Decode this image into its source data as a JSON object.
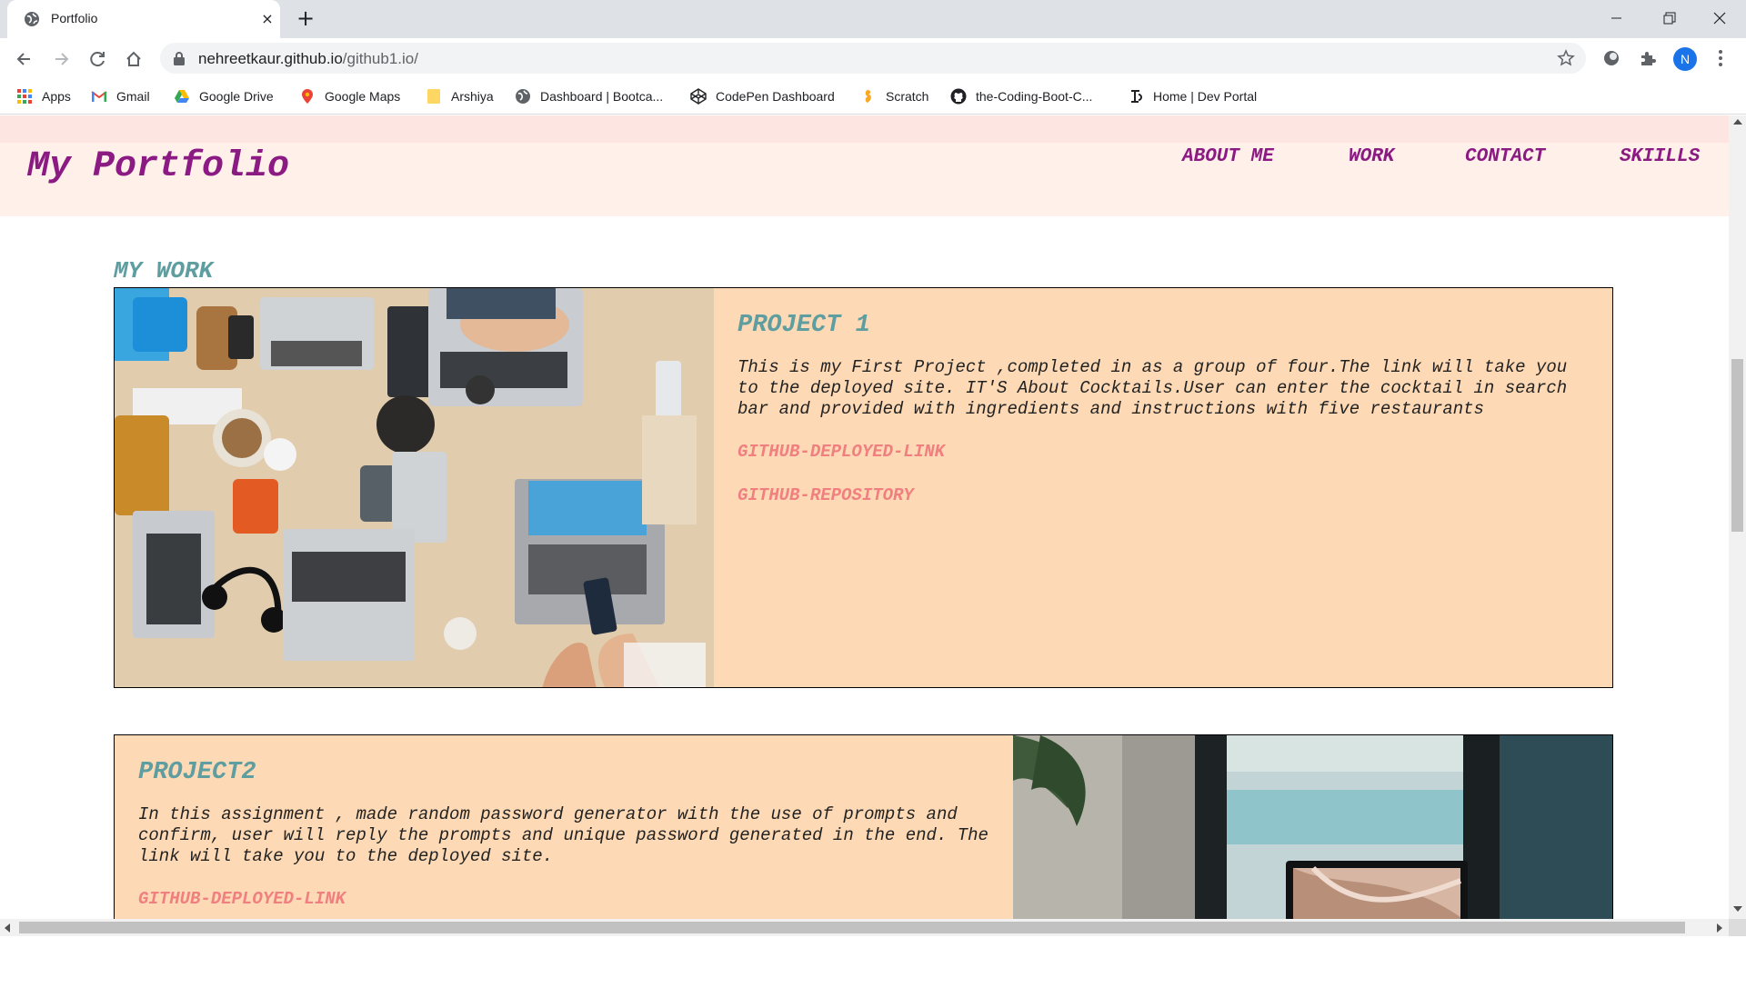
{
  "browser": {
    "tab": {
      "title": "Portfolio",
      "favicon": "globe-icon",
      "close": "×"
    },
    "new_tab": "+",
    "window": {
      "minimize": "—",
      "maximize": "❐",
      "close": "✕"
    },
    "url_host": "nehreetkaur.github.io",
    "url_path": "/github1.io/",
    "avatar_letter": "N",
    "bookmarks": [
      {
        "label": "Apps",
        "icon": "apps-grid-icon"
      },
      {
        "label": "Gmail",
        "icon": "gmail-icon"
      },
      {
        "label": "Google Drive",
        "icon": "google-drive-icon"
      },
      {
        "label": "Google Maps",
        "icon": "google-maps-icon"
      },
      {
        "label": "Arshiya",
        "icon": "folder-icon"
      },
      {
        "label": "Dashboard | Bootca...",
        "icon": "globe-icon"
      },
      {
        "label": "CodePen Dashboard",
        "icon": "codepen-icon"
      },
      {
        "label": "Scratch",
        "icon": "scratch-icon"
      },
      {
        "label": "the-Coding-Boot-C...",
        "icon": "github-icon"
      },
      {
        "label": "Home | Dev Portal",
        "icon": "dev-portal-icon"
      }
    ]
  },
  "site": {
    "title": "My Portfolio",
    "nav": [
      "ABOUT ME",
      "WORK",
      "CONTACT",
      "SKIILLS"
    ],
    "section_title": "MY WORK",
    "projects": [
      {
        "title": "PROJECT 1",
        "description": "This is my First Project ,completed in as a group of four.The link will take you to the deployed site. IT'S About Cocktails.User can enter the cocktail in search bar and provided with ingredients and instructions with five restaurants",
        "links": [
          "GITHUB-DEPLOYED-LINK",
          "GITHUB-REPOSITORY"
        ]
      },
      {
        "title": "PROJECT2",
        "description": "In this assignment , made random password generator with the use of prompts and confirm, user will reply the prompts and unique password generated in the end. The link will take you to the deployed site.",
        "links": [
          "GITHUB-DEPLOYED-LINK"
        ]
      }
    ]
  },
  "colors": {
    "site_title": "#8b1a83",
    "section_heading": "#5f9ea0",
    "card_background": "#fdd9b5",
    "link": "#f08080",
    "header_background": "#fff0ea"
  }
}
